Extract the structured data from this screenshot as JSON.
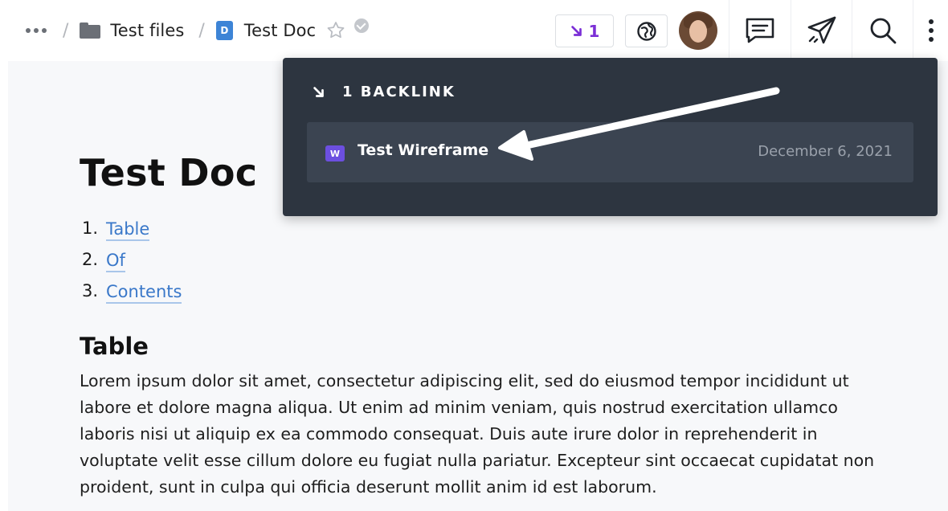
{
  "breadcrumb": {
    "more_icon": "more-horizontal-icon",
    "separator": "/",
    "folder": {
      "icon": "folder-icon",
      "label": "Test files"
    },
    "document": {
      "badge": "D",
      "label": "Test Doc"
    }
  },
  "header": {
    "backlinks_count": "1",
    "icons": [
      "star-icon",
      "verified-check-icon",
      "backlink-arrow-icon",
      "globe-icon",
      "comment-icon",
      "send-icon",
      "search-icon",
      "more-vertical-icon"
    ],
    "colors": {
      "accent_purple": "#7b2fd6",
      "link_blue": "#3a78c9",
      "doc_badge": "#3d84d6",
      "popover_bg": "#2d3540"
    }
  },
  "document": {
    "title": "Test Doc",
    "toc": [
      {
        "num": "1.",
        "label": "Table"
      },
      {
        "num": "2.",
        "label": "Of"
      },
      {
        "num": "3.",
        "label": "Contents"
      }
    ],
    "section_heading": "Table",
    "paragraph": "Lorem ipsum dolor sit amet, consectetur adipiscing elit, sed do eiusmod tempor incididunt ut labore et dolore magna aliqua. Ut enim ad minim veniam, quis nostrud exercitation ullamco laboris nisi ut aliquip ex ea commodo consequat. Duis aute irure dolor in reprehenderit in voluptate velit esse cillum dolore eu fugiat nulla pariatur. Excepteur sint occaecat cupidatat non proident, sunt in culpa qui officia deserunt mollit anim id est laborum."
  },
  "backlinks_popover": {
    "heading": "1 BACKLINK",
    "items": [
      {
        "badge": "W",
        "title": "Test Wireframe",
        "date": "December 6, 2021"
      }
    ]
  }
}
